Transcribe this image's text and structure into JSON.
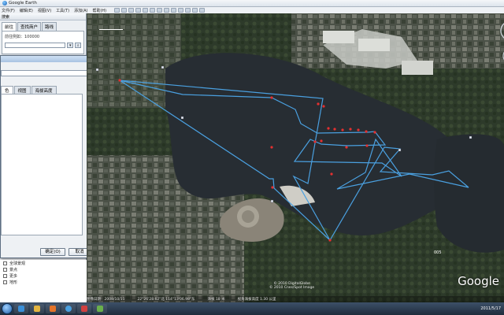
{
  "window": {
    "title": "Google Earth"
  },
  "menu": {
    "items": [
      "文件(F)",
      "编辑(E)",
      "视图(V)",
      "工具(T)",
      "添加(A)",
      "帮助(H)"
    ]
  },
  "sidebar": {
    "search_header": "搜索",
    "tabs": [
      "前往",
      "查找商户",
      "路线"
    ],
    "example_label": "前往例如：100000",
    "search_value": ""
  },
  "dialog": {
    "tabs": [
      "色",
      "视图",
      "海拔高度"
    ],
    "ok_label": "确定(O)",
    "cancel_label": "取消"
  },
  "places": {
    "items": [
      "全球景观",
      "景点",
      "更多",
      "地形"
    ]
  },
  "map": {
    "watermark": "Google",
    "copyright_line1": "© 2010 DigitalGlobe",
    "copyright_line2": "© 2010 Cnes/Spot Image",
    "status_date": "图像日期：2008/10/11",
    "status_coords": "22°26'28.62\"北 114°13'06.98\"东",
    "status_elev": "海拔 18 米",
    "eye_alt": "视角海拔高度 1.30 公里",
    "pin_label": "005"
  },
  "track": {
    "color": "#4aa0e0",
    "point_color": "#e53030"
  },
  "taskbar": {
    "clock": "2011/5/17"
  }
}
